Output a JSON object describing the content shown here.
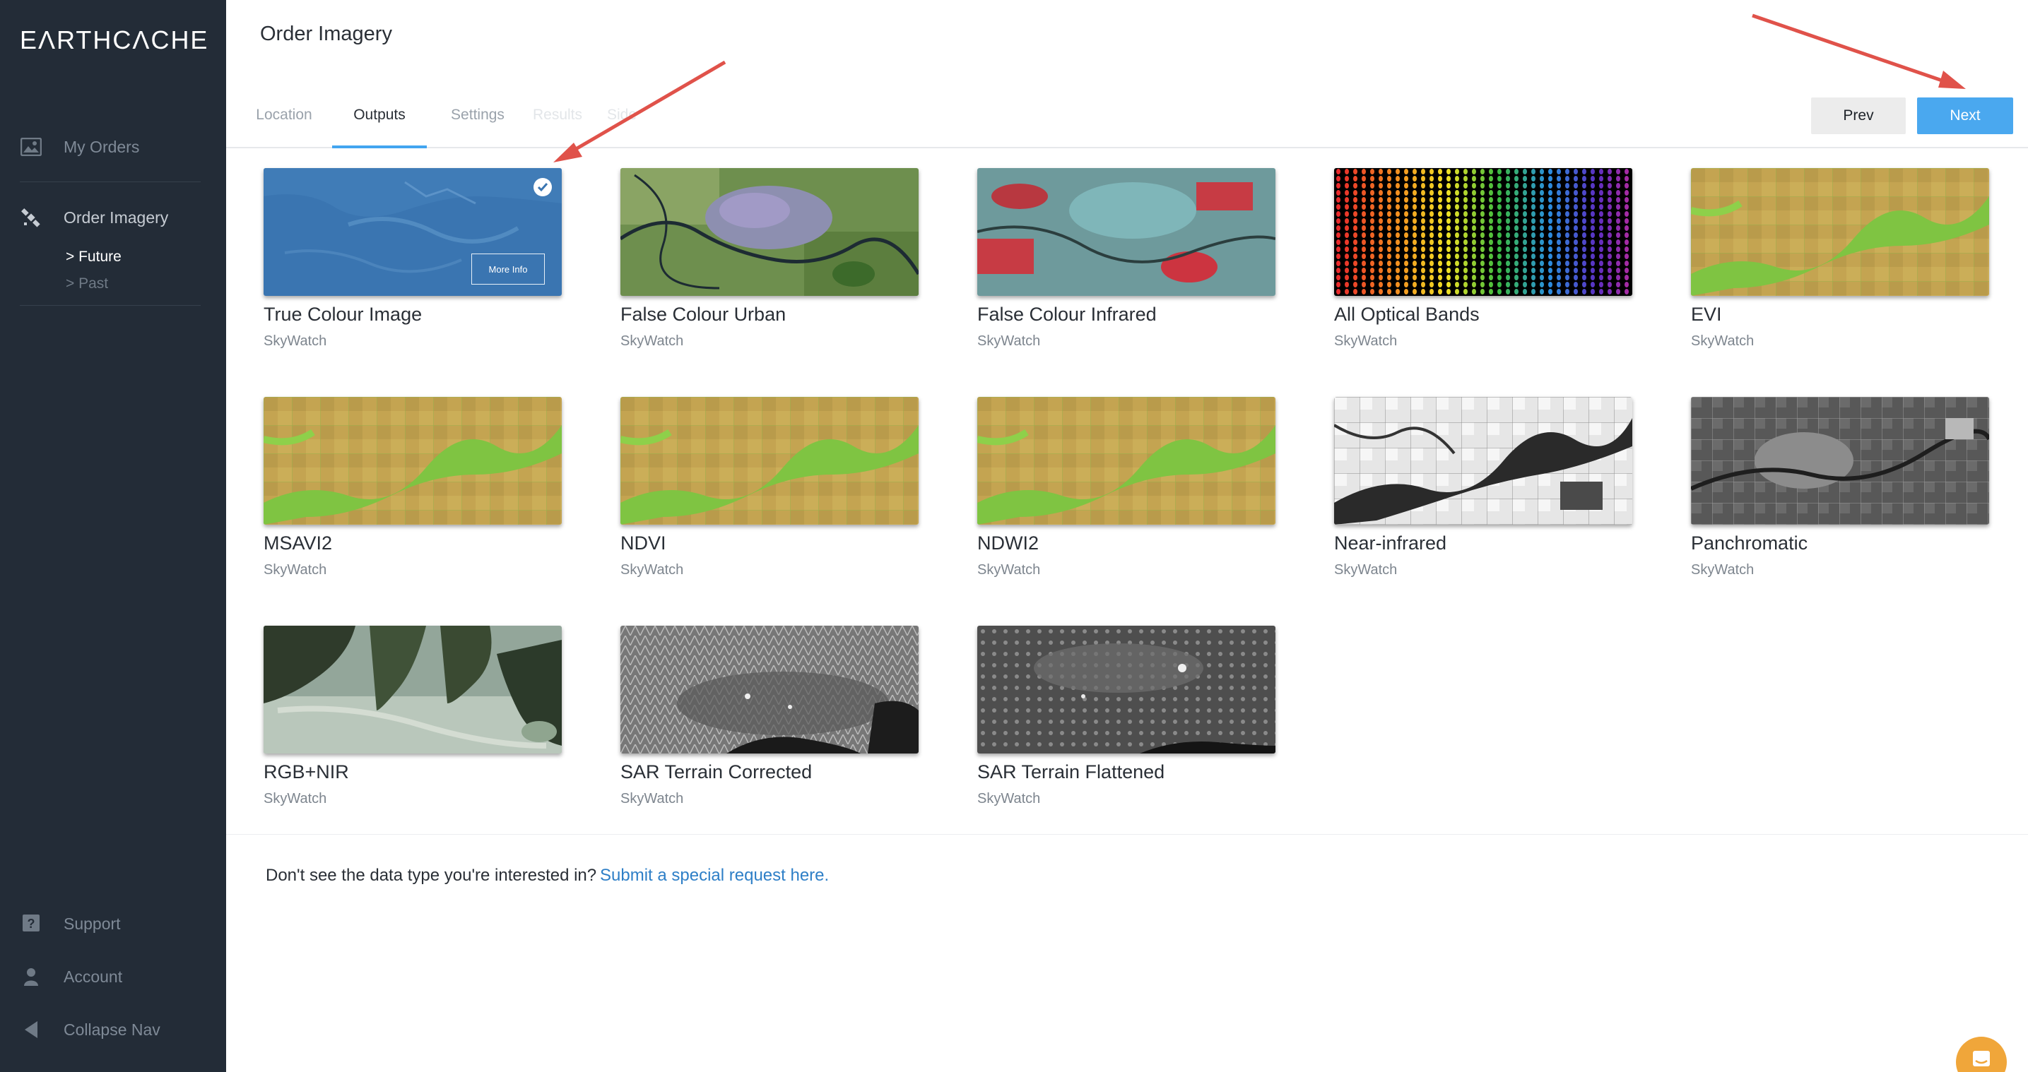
{
  "app": {
    "logo": "EΛRTHCΛCHE"
  },
  "sidebar": {
    "items": [
      {
        "label": "My Orders",
        "icon": "image-icon"
      },
      {
        "label": "Order Imagery",
        "icon": "satellite-icon"
      }
    ],
    "subitems": [
      "> Future",
      "> Past"
    ],
    "bottom_items": [
      {
        "label": "Support",
        "icon": "help-icon"
      },
      {
        "label": "Account",
        "icon": "user-icon"
      },
      {
        "label": "Collapse Nav",
        "icon": "triangle-left-icon"
      }
    ]
  },
  "header": {
    "title": "Order Imagery"
  },
  "tabs": [
    {
      "label": "Location",
      "state": "normal"
    },
    {
      "label": "Outputs",
      "state": "active"
    },
    {
      "label": "Settings",
      "state": "normal"
    },
    {
      "label": "Results",
      "state": "faded"
    },
    {
      "label": "Side",
      "state": "faded"
    }
  ],
  "buttons": {
    "prev": "Prev",
    "next": "Next"
  },
  "outputs": [
    {
      "title": "True Colour Image",
      "provider": "SkyWatch",
      "selected": true,
      "more_info": "More Info"
    },
    {
      "title": "False Colour Urban",
      "provider": "SkyWatch"
    },
    {
      "title": "False Colour Infrared",
      "provider": "SkyWatch"
    },
    {
      "title": "All Optical Bands",
      "provider": "SkyWatch"
    },
    {
      "title": "EVI",
      "provider": "SkyWatch"
    },
    {
      "title": "MSAVI2",
      "provider": "SkyWatch"
    },
    {
      "title": "NDVI",
      "provider": "SkyWatch"
    },
    {
      "title": "NDWI2",
      "provider": "SkyWatch"
    },
    {
      "title": "Near-infrared",
      "provider": "SkyWatch"
    },
    {
      "title": "Panchromatic",
      "provider": "SkyWatch"
    },
    {
      "title": "RGB+NIR",
      "provider": "SkyWatch"
    },
    {
      "title": "SAR Terrain Corrected",
      "provider": "SkyWatch"
    },
    {
      "title": "SAR Terrain Flattened",
      "provider": "SkyWatch"
    }
  ],
  "footer": {
    "text": "Don't see the data type you're interested in?",
    "link": "Submit a special request here."
  },
  "colors": {
    "sidebar_bg": "#232c37",
    "accent": "#4aa8ef",
    "link": "#2e7fc7",
    "annotation_arrow": "#e0524a"
  }
}
